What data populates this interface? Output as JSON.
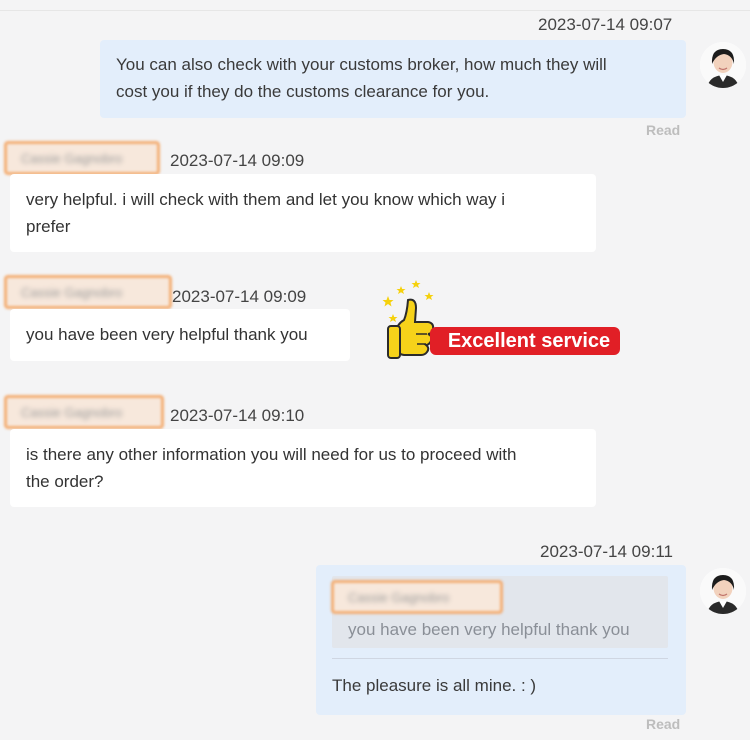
{
  "messages": [
    {
      "time": "2023-07-14 09:07",
      "text_line1": "You can also check with your customs broker, how much they will",
      "text_line2": "cost you if they do the customs clearance for you.",
      "status": "Read"
    },
    {
      "time": "2023-07-14 09:09",
      "text_line1": "very helpful. i will check with them and let you know which way i",
      "text_line2": "prefer"
    },
    {
      "time": "2023-07-14 09:09",
      "text": "you have been very helpful thank you"
    },
    {
      "time": "2023-07-14 09:10",
      "text_line1": "is there any other information you will need for us to proceed with",
      "text_line2": "the order?"
    },
    {
      "time": "2023-07-14 09:11",
      "quoted_text": "you have been very helpful thank you",
      "text": "The pleasure is all mine. : )",
      "status": "Read"
    }
  ],
  "sender_name_blurred": "Cassie Gagnobro",
  "badge": {
    "label": "Excellent service",
    "color": "#e11f26",
    "icon": "thumbs-up-icon"
  },
  "colors": {
    "outgoing_bubble": "#e3eefb",
    "incoming_bubble": "#ffffff",
    "name_highlight": "#f3ae74"
  }
}
